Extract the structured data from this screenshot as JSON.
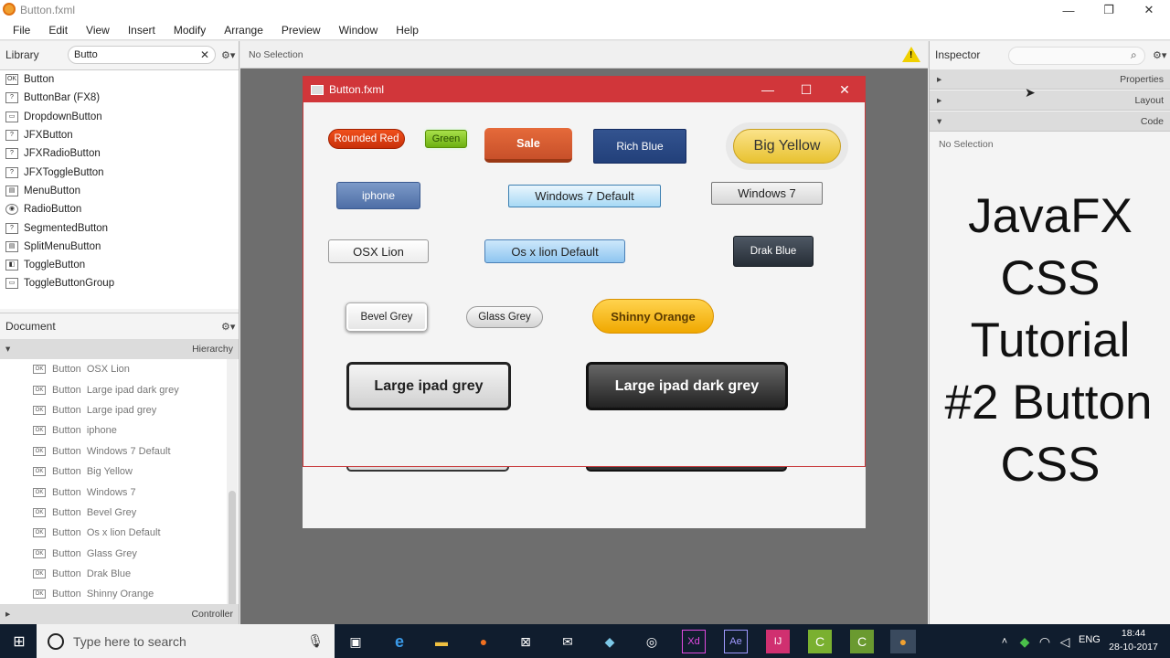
{
  "window": {
    "title": "Button.fxml"
  },
  "menu": [
    "File",
    "Edit",
    "View",
    "Insert",
    "Modify",
    "Arrange",
    "Preview",
    "Window",
    "Help"
  ],
  "library": {
    "title": "Library",
    "search_value": "Butto",
    "items": [
      {
        "label": "Button",
        "icon": "OK"
      },
      {
        "label": "ButtonBar  (FX8)",
        "icon": "?"
      },
      {
        "label": "DropdownButton",
        "icon": "▭"
      },
      {
        "label": "JFXButton",
        "icon": "?"
      },
      {
        "label": "JFXRadioButton",
        "icon": "?"
      },
      {
        "label": "JFXToggleButton",
        "icon": "?"
      },
      {
        "label": "MenuButton",
        "icon": "▤"
      },
      {
        "label": "RadioButton",
        "icon": "◉"
      },
      {
        "label": "SegmentedButton",
        "icon": "?"
      },
      {
        "label": "SplitMenuButton",
        "icon": "▤"
      },
      {
        "label": "ToggleButton",
        "icon": "◧"
      },
      {
        "label": "ToggleButtonGroup",
        "icon": "▭"
      }
    ]
  },
  "document": {
    "title": "Document",
    "hierarchy_label": "Hierarchy",
    "controller_label": "Controller",
    "items": [
      {
        "type": "Button",
        "name": "OSX Lion"
      },
      {
        "type": "Button",
        "name": "Large ipad dark grey"
      },
      {
        "type": "Button",
        "name": "Large ipad grey"
      },
      {
        "type": "Button",
        "name": "iphone"
      },
      {
        "type": "Button",
        "name": "Windows 7 Default"
      },
      {
        "type": "Button",
        "name": "Big Yellow"
      },
      {
        "type": "Button",
        "name": "Windows 7"
      },
      {
        "type": "Button",
        "name": "Bevel Grey"
      },
      {
        "type": "Button",
        "name": "Os x lion Default"
      },
      {
        "type": "Button",
        "name": "Glass Grey"
      },
      {
        "type": "Button",
        "name": "Drak Blue"
      },
      {
        "type": "Button",
        "name": "Shinny Orange"
      }
    ]
  },
  "center": {
    "selection": "No Selection"
  },
  "preview": {
    "title": "Button.fxml",
    "buttons": {
      "rounded_red": "Rounded Red",
      "green": "Green",
      "sale": "Sale",
      "rich_blue": "Rich Blue",
      "big_yellow": "Big Yellow",
      "iphone": "iphone",
      "win7_default": "Windows 7 Default",
      "win7": "Windows 7",
      "osx_lion": "OSX Lion",
      "osx_lion_default": "Os x lion Default",
      "drak_blue": "Drak Blue",
      "bevel_grey": "Bevel Grey",
      "glass_grey": "Glass Grey",
      "shinny_orange": "Shinny Orange",
      "ipad_grey": "Large ipad grey",
      "ipad_dark_grey": "Large ipad dark grey"
    }
  },
  "inspector": {
    "title": "Inspector",
    "sections": [
      "Properties",
      "Layout",
      "Code"
    ],
    "selection": "No Selection",
    "overlay": [
      "JavaFX",
      "CSS",
      "Tutorial",
      "#2 Button",
      "CSS"
    ]
  },
  "taskbar": {
    "search_placeholder": "Type here to search",
    "lang": "ENG",
    "time": "18:44",
    "date": "28-10-2017"
  }
}
